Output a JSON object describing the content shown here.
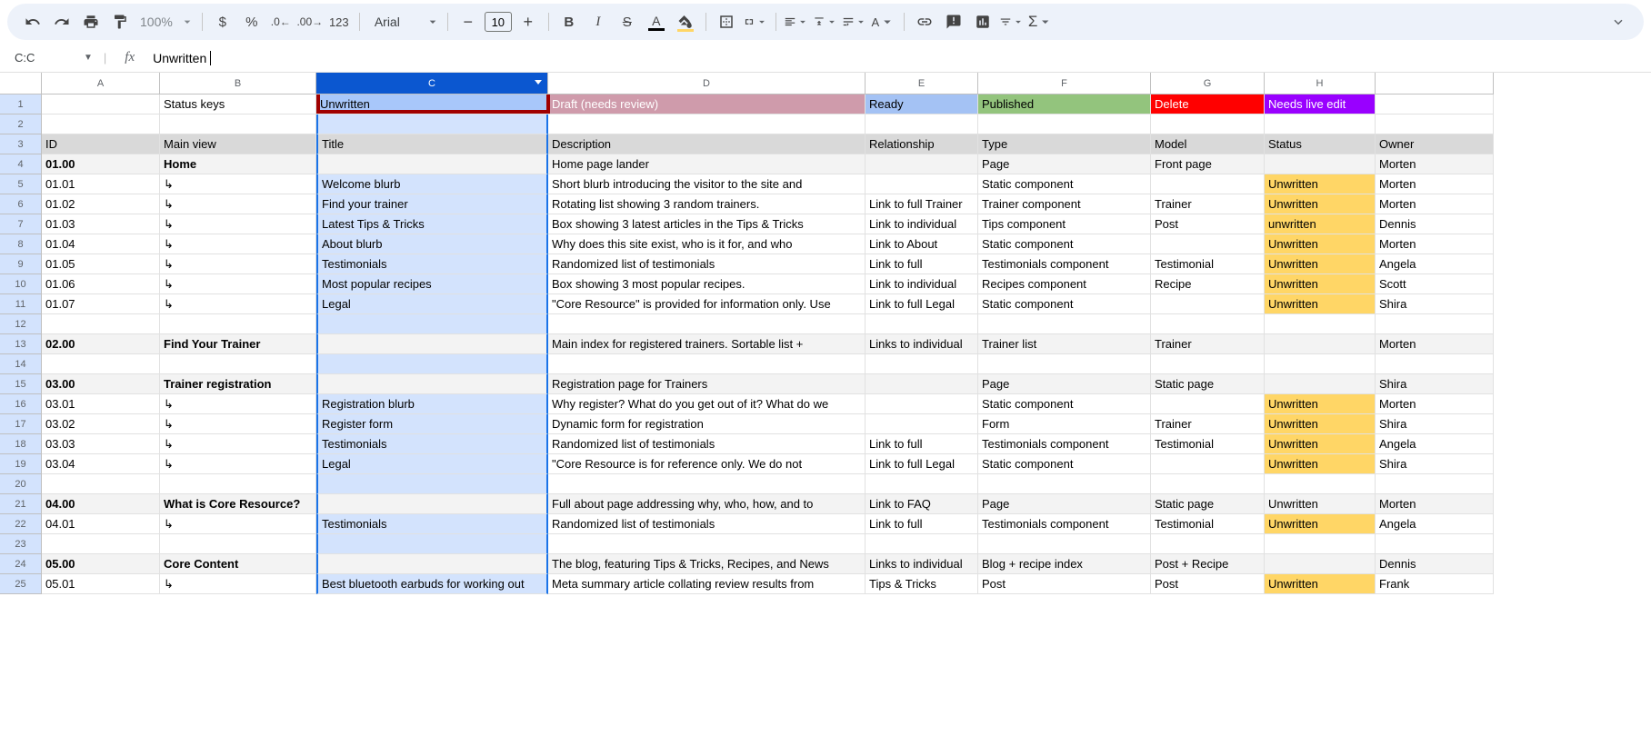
{
  "toolbar": {
    "zoom": "100%",
    "font": "Arial",
    "fontSize": "10"
  },
  "nameBox": "C:C",
  "formula": "Unwritten",
  "columns": [
    "A",
    "B",
    "C",
    "D",
    "E",
    "F",
    "G",
    "H"
  ],
  "statusKeys": {
    "label": "Status keys",
    "unwritten": "Unwritten",
    "draft": "Draft (needs review)",
    "ready": "Ready",
    "published": "Published",
    "delete": "Delete",
    "needsLive": "Needs live edit"
  },
  "headerRow": {
    "id": "ID",
    "mainView": "Main view",
    "title": "Title",
    "description": "Description",
    "relationship": "Relationship",
    "type": "Type",
    "model": "Model",
    "status": "Status",
    "owner": "Owner"
  },
  "rows": [
    {
      "n": 4,
      "sect": true,
      "id": "01.00",
      "mv": "Home",
      "t": "",
      "d": "Home page lander",
      "r": "",
      "ty": "Page",
      "m": "Front page",
      "st": "",
      "o": "Morten"
    },
    {
      "n": 5,
      "id": "01.01",
      "mv": "↳",
      "t": "Welcome blurb",
      "d": "Short blurb introducing the visitor to the site and",
      "r": "",
      "ty": "Static component",
      "m": "",
      "st": "Unwritten",
      "o": "Morten"
    },
    {
      "n": 6,
      "id": "01.02",
      "mv": "↳",
      "t": "Find your trainer",
      "d": "Rotating list showing 3 random trainers.",
      "r": "Link to full Trainer",
      "ty": "Trainer component",
      "m": "Trainer",
      "st": "Unwritten",
      "o": "Morten"
    },
    {
      "n": 7,
      "id": "01.03",
      "mv": "↳",
      "t": "Latest Tips & Tricks",
      "d": "Box showing 3 latest articles in the Tips & Tricks",
      "r": "Link to individual",
      "ty": "Tips component",
      "m": "Post",
      "st": "unwritten",
      "o": "Dennis"
    },
    {
      "n": 8,
      "id": "01.04",
      "mv": "↳",
      "t": "About blurb",
      "d": "Why does this site exist, who is it for, and who",
      "r": "Link to About",
      "ty": "Static component",
      "m": "",
      "st": "Unwritten",
      "o": "Morten"
    },
    {
      "n": 9,
      "id": "01.05",
      "mv": "↳",
      "t": "Testimonials",
      "d": "Randomized list of testimonials",
      "r": "Link to full",
      "ty": "Testimonials component",
      "m": "Testimonial",
      "st": "Unwritten",
      "o": "Angela"
    },
    {
      "n": 10,
      "id": "01.06",
      "mv": "↳",
      "t": "Most popular recipes",
      "d": "Box showing 3 most popular recipes.",
      "r": "Link to individual",
      "ty": "Recipes component",
      "m": "Recipe",
      "st": "Unwritten",
      "o": "Scott"
    },
    {
      "n": 11,
      "id": "01.07",
      "mv": "↳",
      "t": "Legal",
      "d": "\"Core Resource\" is provided for information only. Use",
      "r": "Link to full Legal",
      "ty": "Static component",
      "m": "",
      "st": "Unwritten",
      "o": "Shira"
    },
    {
      "n": 12,
      "blank": true
    },
    {
      "n": 13,
      "sect": true,
      "id": "02.00",
      "mv": "Find Your Trainer",
      "t": "",
      "d": "Main index for registered trainers. Sortable list +",
      "r": "Links to individual",
      "ty": "Trainer list",
      "m": "Trainer",
      "st": "",
      "o": "Morten"
    },
    {
      "n": 14,
      "blank": true
    },
    {
      "n": 15,
      "sect": true,
      "id": "03.00",
      "mv": "Trainer registration",
      "t": "",
      "d": "Registration page for Trainers",
      "r": "",
      "ty": "Page",
      "m": "Static page",
      "st": "",
      "o": "Shira"
    },
    {
      "n": 16,
      "id": "03.01",
      "mv": "↳",
      "t": "Registration blurb",
      "d": "Why register? What do you get out of it? What do we",
      "r": "",
      "ty": "Static component",
      "m": "",
      "st": "Unwritten",
      "o": "Morten"
    },
    {
      "n": 17,
      "id": "03.02",
      "mv": "↳",
      "t": "Register form",
      "d": "Dynamic form for registration",
      "r": "",
      "ty": "Form",
      "m": "Trainer",
      "st": "Unwritten",
      "o": "Shira"
    },
    {
      "n": 18,
      "id": "03.03",
      "mv": "↳",
      "t": "Testimonials",
      "d": "Randomized list of testimonials",
      "r": "Link to full",
      "ty": "Testimonials component",
      "m": "Testimonial",
      "st": "Unwritten",
      "o": "Angela"
    },
    {
      "n": 19,
      "id": "03.04",
      "mv": "↳",
      "t": "Legal",
      "d": "\"Core Resource is for reference only. We do not",
      "r": "Link to full Legal",
      "ty": "Static component",
      "m": "",
      "st": "Unwritten",
      "o": "Shira"
    },
    {
      "n": 20,
      "blank": true
    },
    {
      "n": 21,
      "sect": true,
      "id": "04.00",
      "mv": "What is Core Resource?",
      "t": "",
      "d": "Full about page addressing why, who, how, and to",
      "r": "Link to FAQ",
      "ty": "Page",
      "m": "Static page",
      "st": "Unwritten",
      "o": "Morten"
    },
    {
      "n": 22,
      "id": "04.01",
      "mv": "↳",
      "t": "Testimonials",
      "d": "Randomized list of testimonials",
      "r": "Link to full",
      "ty": "Testimonials component",
      "m": "Testimonial",
      "st": "Unwritten",
      "o": "Angela"
    },
    {
      "n": 23,
      "blank": true
    },
    {
      "n": 24,
      "sect": true,
      "id": "05.00",
      "mv": "Core Content",
      "t": "",
      "d": "The blog, featuring Tips & Tricks, Recipes, and News",
      "r": "Links to individual",
      "ty": "Blog + recipe index",
      "m": "Post + Recipe",
      "st": "",
      "o": "Dennis"
    },
    {
      "n": 25,
      "id": "05.01",
      "mv": "↳",
      "t": "Best bluetooth earbuds for working out",
      "d": "Meta summary article collating review results from",
      "r": "Tips & Tricks",
      "ty": "Post",
      "m": "Post",
      "st": "Unwritten",
      "o": "Frank"
    }
  ]
}
